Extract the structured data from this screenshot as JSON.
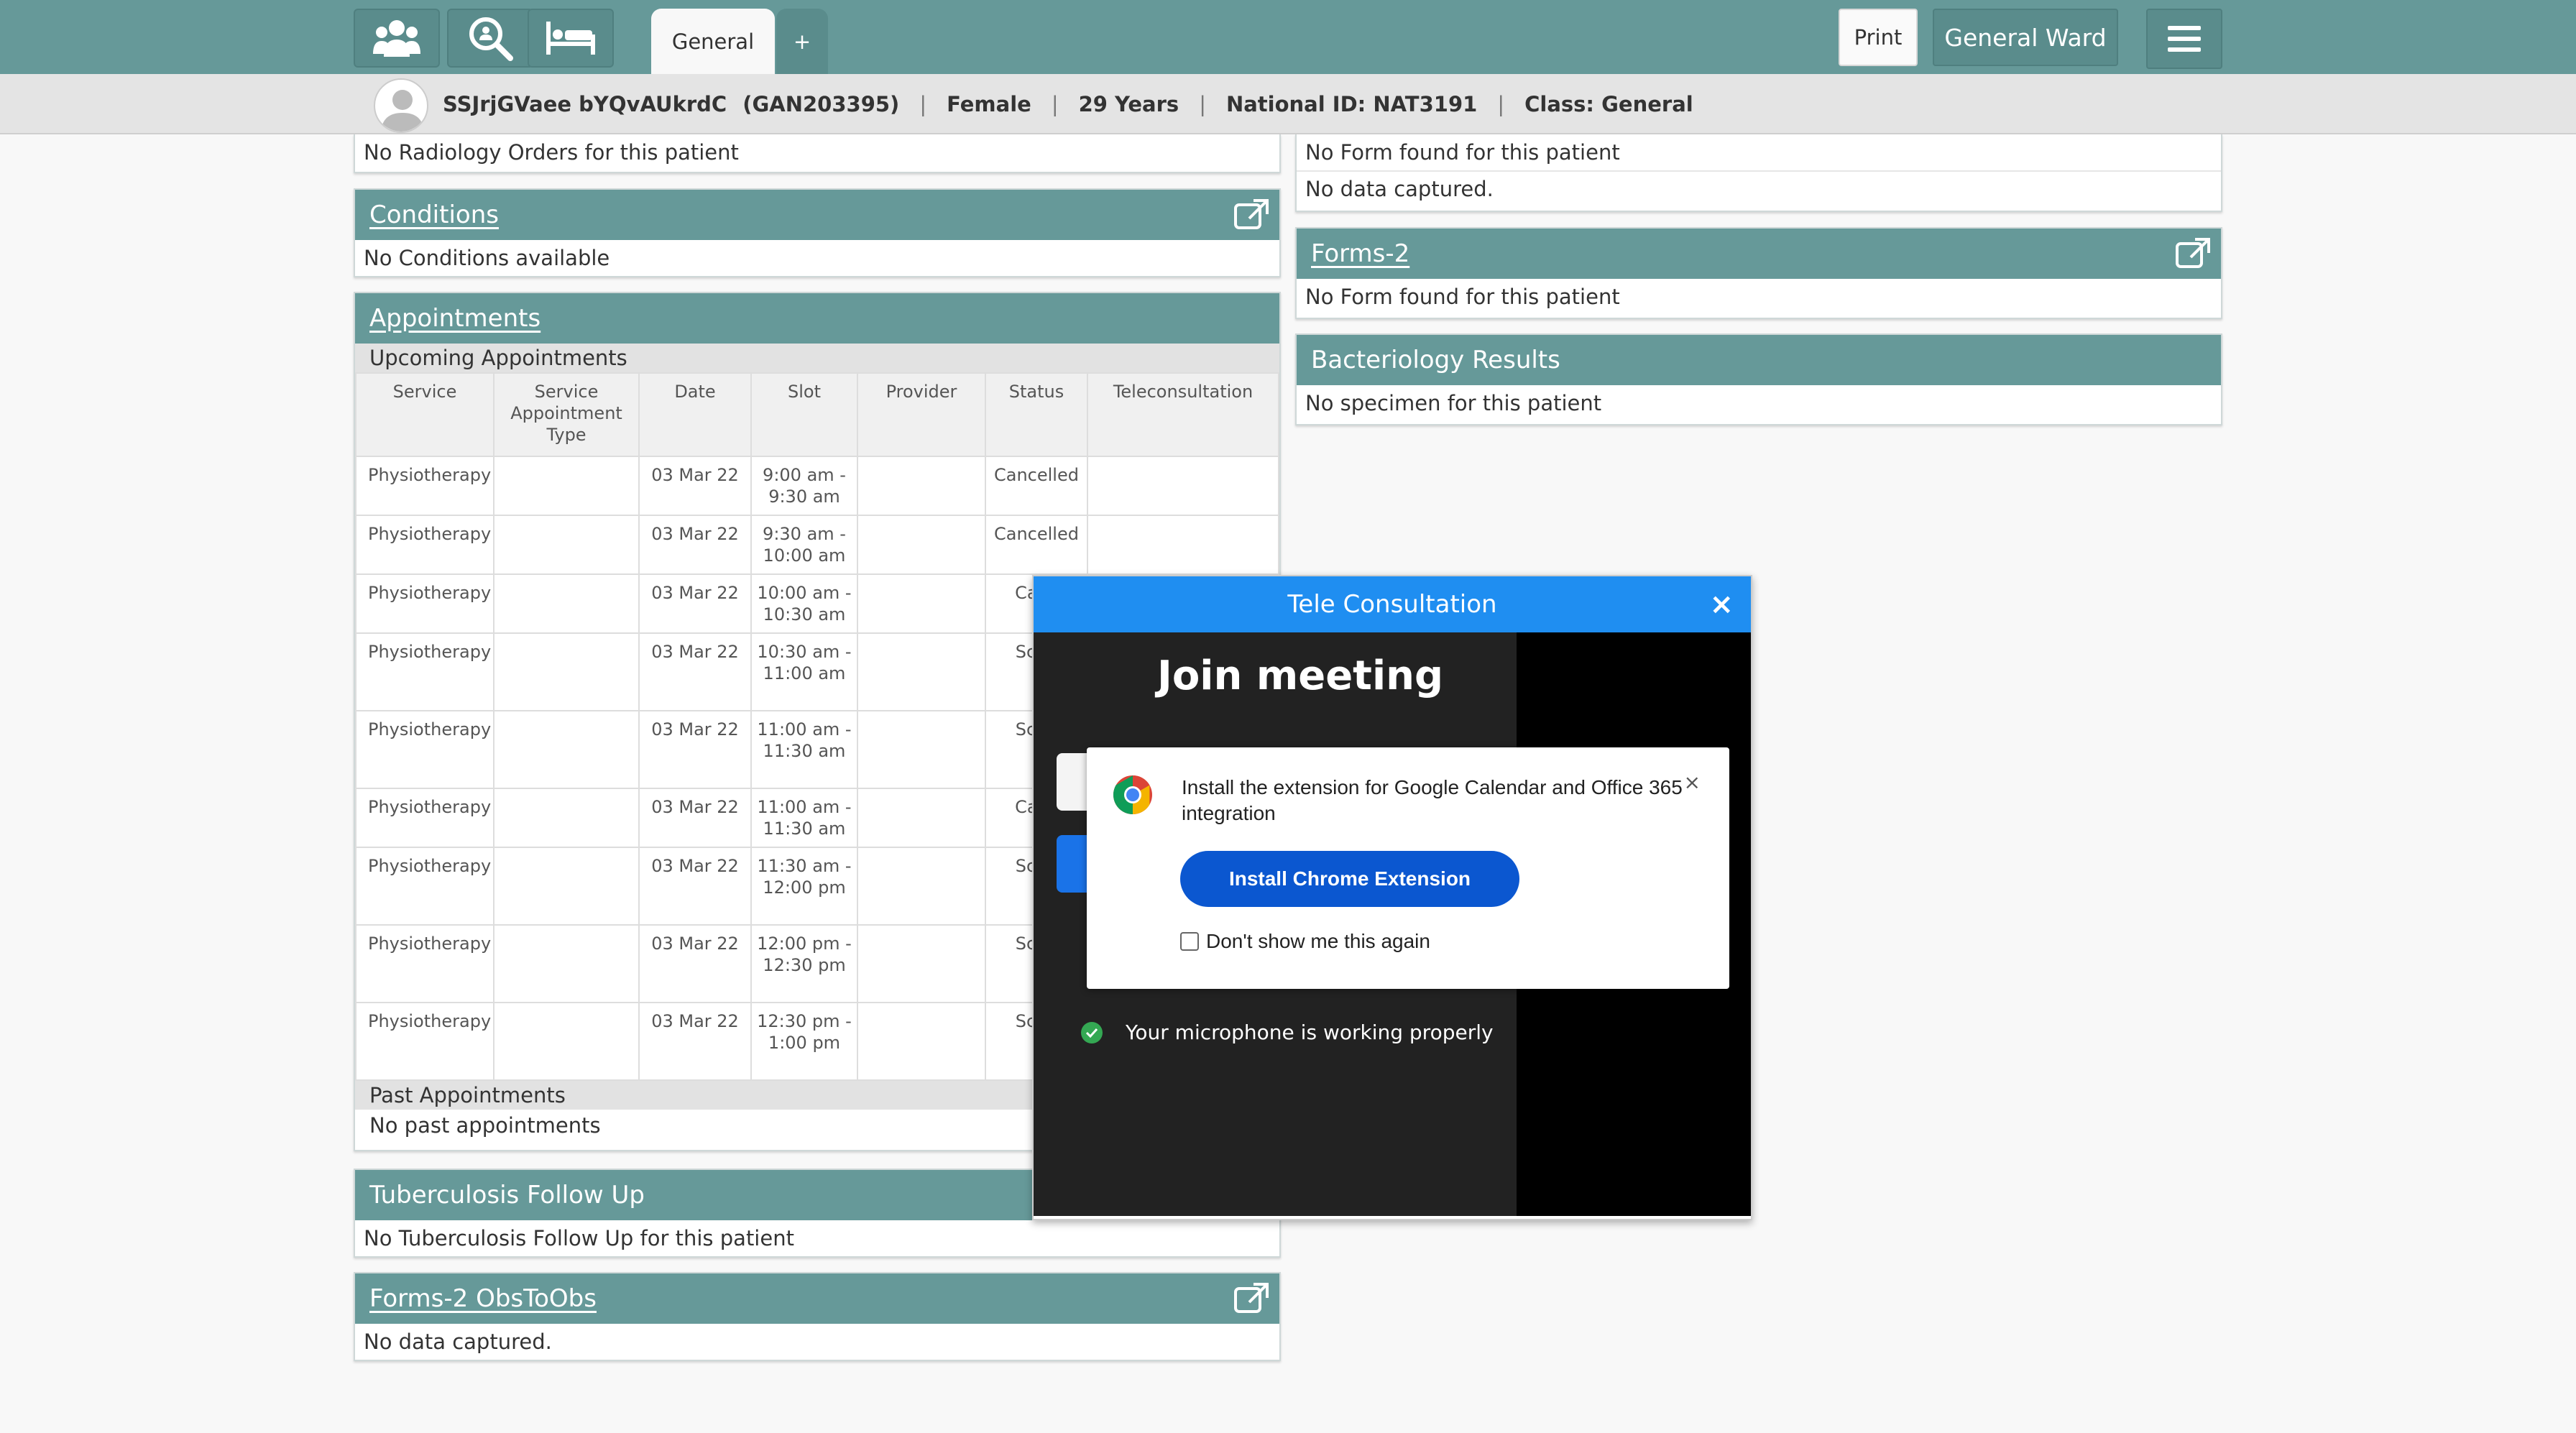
{
  "toolbar": {
    "tabs": [
      {
        "label": "General"
      },
      {
        "label": "+"
      }
    ],
    "print_label": "Print",
    "ward_label": "General Ward",
    "accent": "#669999"
  },
  "patient": {
    "name": "SSJrjGVaee bYQvAUkrdC",
    "id": "(GAN203395)",
    "gender": "Female",
    "age": "29 Years",
    "national_id": "National ID: NAT3191",
    "class": "Class: General"
  },
  "left": {
    "radiology": {
      "message": "No Radiology Orders for this patient"
    },
    "conditions": {
      "title": "Conditions",
      "message": "No Conditions available"
    },
    "appointments": {
      "title": "Appointments",
      "upcoming_label": "Upcoming Appointments",
      "columns": [
        "Service",
        "Service Appointment Type",
        "Date",
        "Slot",
        "Provider",
        "Status",
        "Teleconsultation"
      ],
      "rows": [
        {
          "service": "Physiotherapy",
          "type": "",
          "date": "03 Mar 22",
          "slot": "9:00 am - 9:30 am",
          "provider": "",
          "status": "Cancelled",
          "tele": ""
        },
        {
          "service": "Physiotherapy",
          "type": "",
          "date": "03 Mar 22",
          "slot": "9:30 am - 10:00 am",
          "provider": "",
          "status": "Cancelled",
          "tele": ""
        },
        {
          "service": "Physiotherapy",
          "type": "",
          "date": "03 Mar 22",
          "slot": "10:00 am - 10:30 am",
          "provider": "",
          "status": "Canc",
          "tele": ""
        },
        {
          "service": "Physiotherapy",
          "type": "",
          "date": "03 Mar 22",
          "slot": "10:30 am - 11:00 am",
          "provider": "",
          "status": "Sche",
          "tele": ""
        },
        {
          "service": "Physiotherapy",
          "type": "",
          "date": "03 Mar 22",
          "slot": "11:00 am - 11:30 am",
          "provider": "",
          "status": "Sche",
          "tele": ""
        },
        {
          "service": "Physiotherapy",
          "type": "",
          "date": "03 Mar 22",
          "slot": "11:00 am - 11:30 am",
          "provider": "",
          "status": "Canc",
          "tele": ""
        },
        {
          "service": "Physiotherapy",
          "type": "",
          "date": "03 Mar 22",
          "slot": "11:30 am - 12:00 pm",
          "provider": "",
          "status": "Sche",
          "tele": ""
        },
        {
          "service": "Physiotherapy",
          "type": "",
          "date": "03 Mar 22",
          "slot": "12:00 pm - 12:30 pm",
          "provider": "",
          "status": "Sche",
          "tele": ""
        },
        {
          "service": "Physiotherapy",
          "type": "",
          "date": "03 Mar 22",
          "slot": "12:30 pm - 1:00 pm",
          "provider": "",
          "status": "Sche",
          "tele": ""
        }
      ],
      "past_label": "Past Appointments",
      "past_message": "No past appointments"
    },
    "tb_followup": {
      "title": "Tuberculosis Follow Up",
      "message": "No Tuberculosis Follow Up for this patient"
    },
    "forms_obs": {
      "title": "Forms-2 ObsToObs",
      "message": "No data captured."
    }
  },
  "right": {
    "forms_top": {
      "message1": "No Form found for this patient",
      "message2": "No data captured."
    },
    "forms2": {
      "title": "Forms-2",
      "message": "No Form found for this patient"
    },
    "bacteriology": {
      "title": "Bacteriology Results",
      "message": "No specimen for this patient"
    }
  },
  "modal": {
    "title": "Tele Consultation",
    "close": "×",
    "join_title": "Join meeting",
    "mic_status": "Your microphone is working properly",
    "extension": {
      "message": "Install the extension for Google Calendar and Office 365 integration",
      "close": "×",
      "install_label": "Install Chrome Extension",
      "dont_show_label": "Don't show me this again"
    }
  }
}
